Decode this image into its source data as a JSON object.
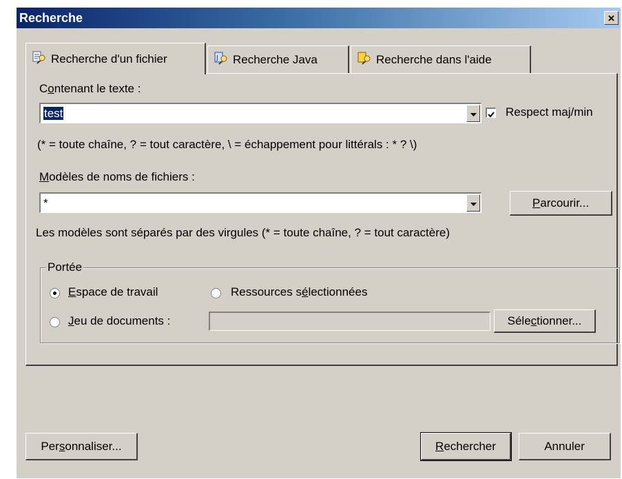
{
  "window": {
    "title": "Recherche",
    "close_glyph": "×"
  },
  "tabs": [
    {
      "label": "Recherche d'un fichier",
      "icon": "file-search-icon",
      "active": true
    },
    {
      "label": "Recherche Java",
      "icon": "java-search-icon",
      "active": false
    },
    {
      "label": "Recherche dans l'aide",
      "icon": "help-search-icon",
      "active": false
    }
  ],
  "containing_text": {
    "label_pre": "C",
    "label_u": "o",
    "label_post": "ntenant le texte :",
    "value": "test",
    "hint": "(* = toute chaîne, ? = tout caractère, \\ = échappement pour littérals : * ? \\)"
  },
  "case_sensitive": {
    "label": "Respect maj/min",
    "checked": true
  },
  "file_patterns": {
    "label_u": "M",
    "label_post": "odèles de noms de fichiers :",
    "value": "*",
    "hint": "Les modèles sont séparés par des virgules (* = toute chaîne, ? = tout caractère)"
  },
  "browse_button": {
    "label_u": "P",
    "label_post": "arcourir..."
  },
  "scope": {
    "legend": "Portée",
    "workspace": {
      "label_u": "E",
      "label_post": "space de travail",
      "selected": true
    },
    "selected_resources": {
      "label_pre": "Ressources s",
      "label_u": "é",
      "label_post": "lectionnées",
      "selected": false
    },
    "working_set": {
      "label_u": "J",
      "label_post": "eu de documents :",
      "selected": false,
      "value": ""
    },
    "select_button": {
      "label_pre": "Séle",
      "label_u": "c",
      "label_post": "tionner..."
    }
  },
  "footer": {
    "customize": {
      "label_pre": "Per",
      "label_u": "s",
      "label_post": "onnaliser..."
    },
    "search": {
      "label_u": "R",
      "label_post": "echercher"
    },
    "cancel": {
      "label": "Annuler"
    }
  },
  "colors": {
    "face": "#d4d0c8",
    "title_start": "#0a246a",
    "title_end": "#a6caf0",
    "selection": "#0a246a"
  }
}
